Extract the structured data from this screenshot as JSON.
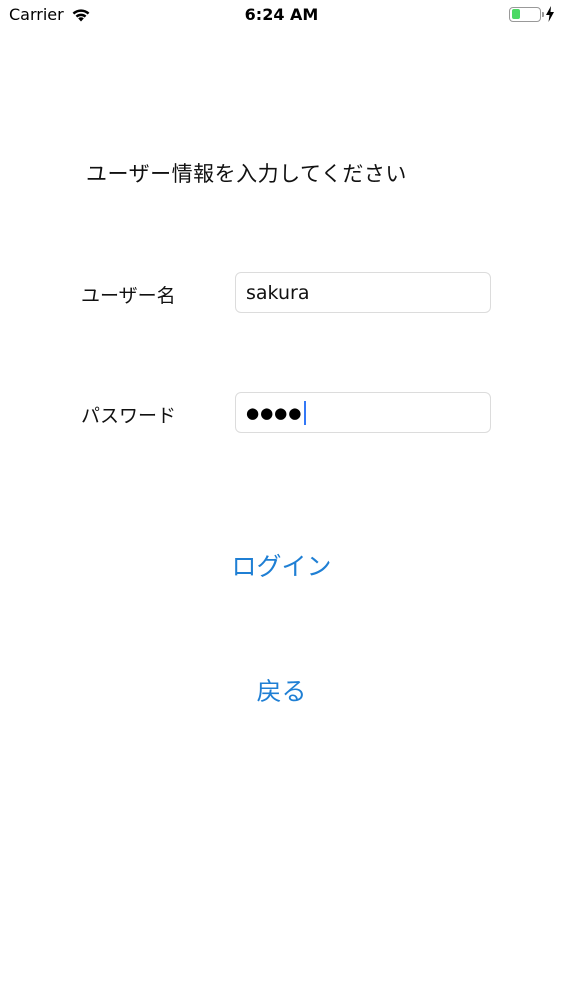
{
  "status_bar": {
    "carrier": "Carrier",
    "time": "6:24 AM",
    "battery_level": 0.3,
    "battery_color": "#4cd964",
    "wifi_icon": "wifi-icon",
    "charging_icon": "bolt-icon"
  },
  "heading": "ユーザー情報を入力してください",
  "username": {
    "label": "ユーザー名",
    "value": "sakura"
  },
  "password": {
    "label": "パスワード",
    "masked_value": "●●●●"
  },
  "buttons": {
    "login": "ログイン",
    "back": "戻る"
  },
  "colors": {
    "link": "#1f7fd4",
    "caret": "#3478f6"
  }
}
